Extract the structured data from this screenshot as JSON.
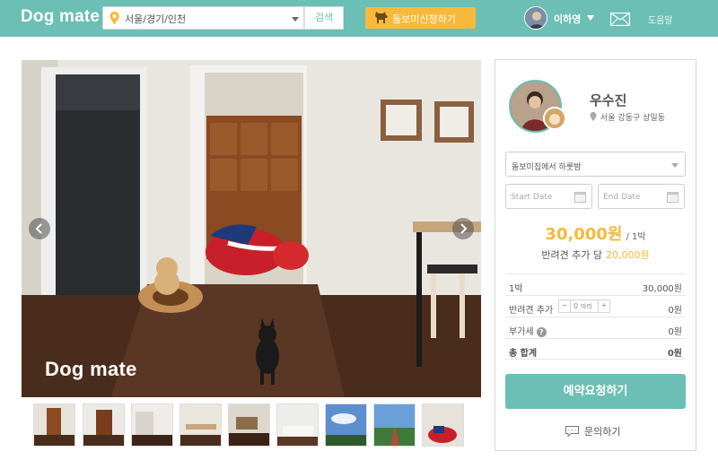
{
  "header": {
    "logo": "Dog mate",
    "search": {
      "value": "서울/경기/인천",
      "button": "검색"
    },
    "apply_button": "돌보미신청하기",
    "user_name": "이하영",
    "help": "도움말"
  },
  "photo": {
    "watermark": "Dog mate"
  },
  "thumbnails": [
    {
      "name": "thumb-1"
    },
    {
      "name": "thumb-2"
    },
    {
      "name": "thumb-3"
    },
    {
      "name": "thumb-4"
    },
    {
      "name": "thumb-5"
    },
    {
      "name": "thumb-6"
    },
    {
      "name": "thumb-7"
    },
    {
      "name": "thumb-8"
    },
    {
      "name": "thumb-9"
    }
  ],
  "host": {
    "name": "우수진",
    "location": "서울 강동구 상일동"
  },
  "booking": {
    "service": "돌보미집에서 하룻밤",
    "start_placeholder": "Start Date",
    "end_placeholder": "End Date",
    "price": "30,000원",
    "price_unit": "/ 1박",
    "extra_label": "반려견 추가 당",
    "extra_value": "20,000원",
    "rows": {
      "night_label": "1박",
      "night_value": "30,000원",
      "dog_label": "반려견 추가",
      "dog_count": "0",
      "dog_unit": "마리",
      "dog_value": "0원",
      "vat_label": "부가세",
      "vat_value": "0원",
      "total_label": "총 합계",
      "total_value": "0원"
    },
    "reserve_button": "예약요청하기",
    "inquiry": "문의하기"
  },
  "colors": {
    "teal": "#6cbfb5",
    "orange": "#f6b93b"
  }
}
